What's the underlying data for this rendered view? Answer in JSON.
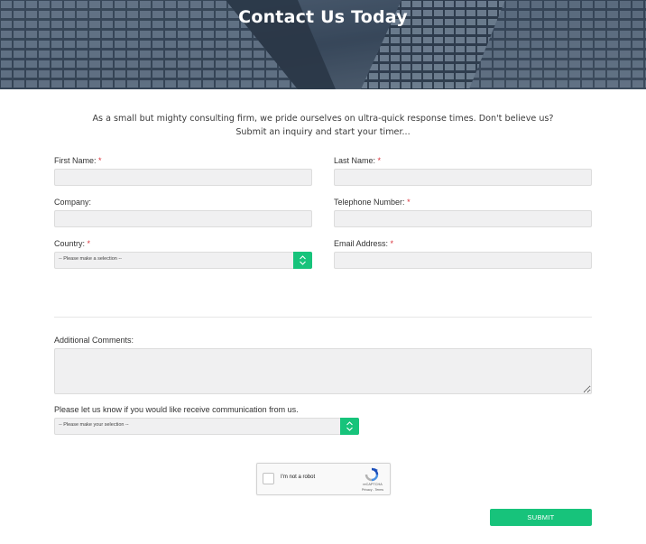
{
  "header": {
    "title": "Contact Us Today"
  },
  "intro": {
    "line1": "As a small but mighty consulting firm, we pride ourselves on ultra-quick response times. Don't believe us?",
    "line2": "Submit an inquiry and start your timer..."
  },
  "form": {
    "required_marker": "*",
    "first_name_label": "First Name:",
    "last_name_label": "Last Name:",
    "company_label": "Company:",
    "telephone_label": "Telephone Number:",
    "country_label": "Country:",
    "country_value": "-- Please make a selection --",
    "email_label": "Email Address:",
    "comments_label": "Additional Comments:",
    "communication_label": "Please let us know if you would like receive communication from us.",
    "communication_value": "-- Please make your selection --",
    "submit_label": "SUBMIT"
  },
  "recaptcha": {
    "checkbox_label": "I'm not a robot",
    "brand": "reCAPTCHA",
    "terms": "Privacy - Terms"
  },
  "colors": {
    "accent": "#17c37b",
    "required": "#d9313a",
    "field_bg": "#f0f0f1"
  }
}
